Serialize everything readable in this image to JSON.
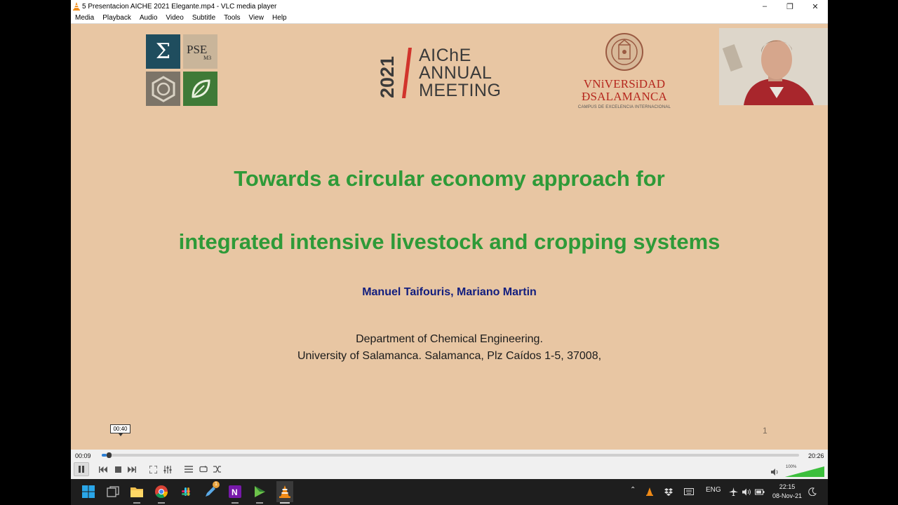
{
  "window": {
    "title": "5 Presentacion AICHE 2021 Elegante.mp4 - VLC media player",
    "controls": {
      "minimize": "–",
      "maximize": "❐",
      "close": "✕"
    }
  },
  "menu": [
    "Media",
    "Playback",
    "Audio",
    "Video",
    "Subtitle",
    "Tools",
    "View",
    "Help"
  ],
  "slide": {
    "pse_logo": {
      "sigma": "Σ",
      "pse": "PSE",
      "sub": "M3"
    },
    "aiche": {
      "year": "2021",
      "line1": "AIChE",
      "line2": "ANNUAL",
      "line3": "MEETING"
    },
    "university": {
      "line1": "VNiVERSiDAD",
      "line2": "ÐSALAMANCA",
      "line3": "CAMPUS DE EXCELENCIA INTERNACIONAL"
    },
    "title_line1": "Towards a circular economy approach for",
    "title_line2": "integrated intensive livestock and cropping systems",
    "authors": "Manuel Taifouris, Mariano Martin",
    "dept_line1": "Department of Chemical Engineering.",
    "dept_line2": "University of Salamanca. Salamanca, Plz Caídos 1-5, 37008,",
    "page_number": "1"
  },
  "player": {
    "tooltip_time": "00:40",
    "elapsed": "00:09",
    "total": "20:26",
    "progress": 0.007,
    "volume_label": "100%",
    "volume": 1.0,
    "colors": {
      "seek": "#2b7fd4",
      "volume": "#3cbf3c",
      "vlc_orange": "#f18b16"
    }
  },
  "taskbar": {
    "language": "ENG",
    "time": "22:15",
    "date": "08-Nov-21",
    "notification_badge": "1"
  }
}
